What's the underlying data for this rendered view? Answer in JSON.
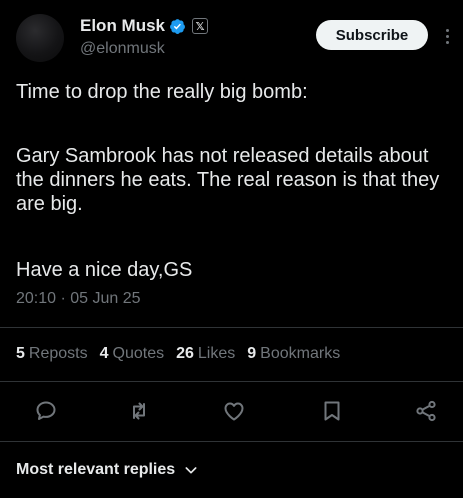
{
  "header": {
    "name": "Elon Musk",
    "handle": "@elonmusk",
    "subscribe_label": "Subscribe",
    "badge_label": "𝕏",
    "verified_color": "#1d9bf0"
  },
  "post": {
    "paragraph1": "Time to drop the really big bomb:",
    "paragraph2": "Gary Sambrook has not released details about the dinners he eats. The real reason is that they are big.",
    "paragraph3": "Have a nice day,GS",
    "timestamp": "20:10 · 05 Jun 25"
  },
  "stats": [
    {
      "count": "5",
      "label": "Reposts"
    },
    {
      "count": "4",
      "label": "Quotes"
    },
    {
      "count": "26",
      "label": "Likes"
    },
    {
      "count": "9",
      "label": "Bookmarks"
    }
  ],
  "actions": [
    "reply-icon",
    "repost-icon",
    "like-icon",
    "bookmark-icon",
    "share-icon"
  ],
  "replies": {
    "sort_label": "Most relevant replies"
  }
}
